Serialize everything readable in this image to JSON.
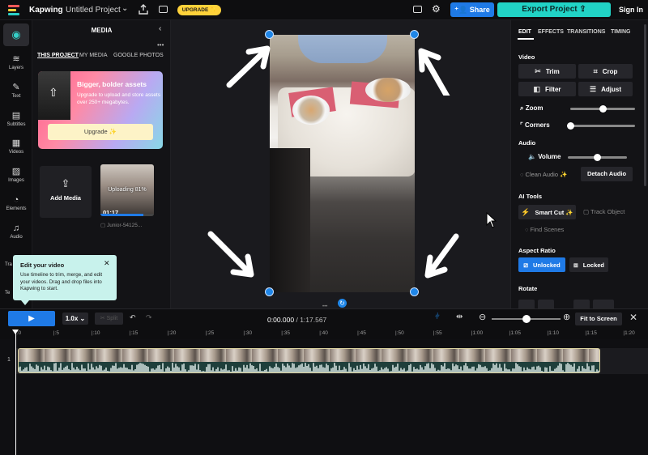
{
  "topbar": {
    "brand": "Kapwing",
    "project_title": "Untitled Project",
    "upgrade_label": "UPGRADE ✨",
    "share_label": "Share",
    "export_label": "Export Project",
    "signin_label": "Sign In"
  },
  "rail": {
    "items": [
      {
        "label": "Layers",
        "icon": "≋"
      },
      {
        "label": "Text",
        "icon": "✎"
      },
      {
        "label": "Subtitles",
        "icon": "▤"
      },
      {
        "label": "Videos",
        "icon": "▦"
      },
      {
        "label": "Images",
        "icon": "▨"
      },
      {
        "label": "Elements",
        "icon": "◔"
      },
      {
        "label": "Audio",
        "icon": "♫"
      }
    ],
    "low_labels": [
      "Tra",
      "Te"
    ]
  },
  "media": {
    "title": "MEDIA",
    "tabs": [
      "THIS PROJECT",
      "MY MEDIA",
      "GOOGLE PHOTOS"
    ],
    "promo_title": "Bigger, bolder assets",
    "promo_text": "Upgrade to upload and store assets over 250+ megabytes.",
    "promo_button": "Upgrade ✨",
    "add_media_label": "Add Media",
    "upload_status": "Uploading",
    "upload_percent": "81%",
    "upload_progress": 0.81,
    "thumb_duration": "01:17",
    "thumb_name": "Junior-54125..."
  },
  "tip": {
    "title": "Edit your video",
    "body": "Use timeline to trim, merge, and edit your videos. Drag and drop files into Kapwing to start."
  },
  "right": {
    "tabs": [
      "EDIT",
      "EFFECTS",
      "TRANSITIONS",
      "TIMING"
    ],
    "video_section": "Video",
    "trim": "Trim",
    "crop": "Crop",
    "filter": "Filter",
    "adjust": "Adjust",
    "zoom": "Zoom",
    "zoom_level": 0.5,
    "corners": "Corners",
    "corners_level": 0.0,
    "audio_section": "Audio",
    "volume": "Volume",
    "volume_level": 0.5,
    "clean_audio": "Clean Audio ✨",
    "detach_audio": "Detach Audio",
    "ai_section": "AI Tools",
    "smart_cut": "Smart Cut ✨",
    "track_object": "Track Object",
    "find_scenes": "Find Scenes",
    "aspect_section": "Aspect Ratio",
    "unlocked": "Unlocked",
    "locked": "Locked",
    "rotate_section": "Rotate"
  },
  "timeline": {
    "speed": "1.0x",
    "split": "Split",
    "current_time": "0:00.000",
    "separator": " / ",
    "total_time": "1:17.567",
    "fit_label": "Fit to Screen",
    "track_number": "1",
    "ruler": [
      ":0",
      ":5",
      ":10",
      ":15",
      ":20",
      ":25",
      ":30",
      ":35",
      ":40",
      ":45",
      ":50",
      ":55",
      "1:00",
      "1:05",
      "1:10",
      "1:15",
      "1:20"
    ],
    "zoom_level": 0.5
  }
}
